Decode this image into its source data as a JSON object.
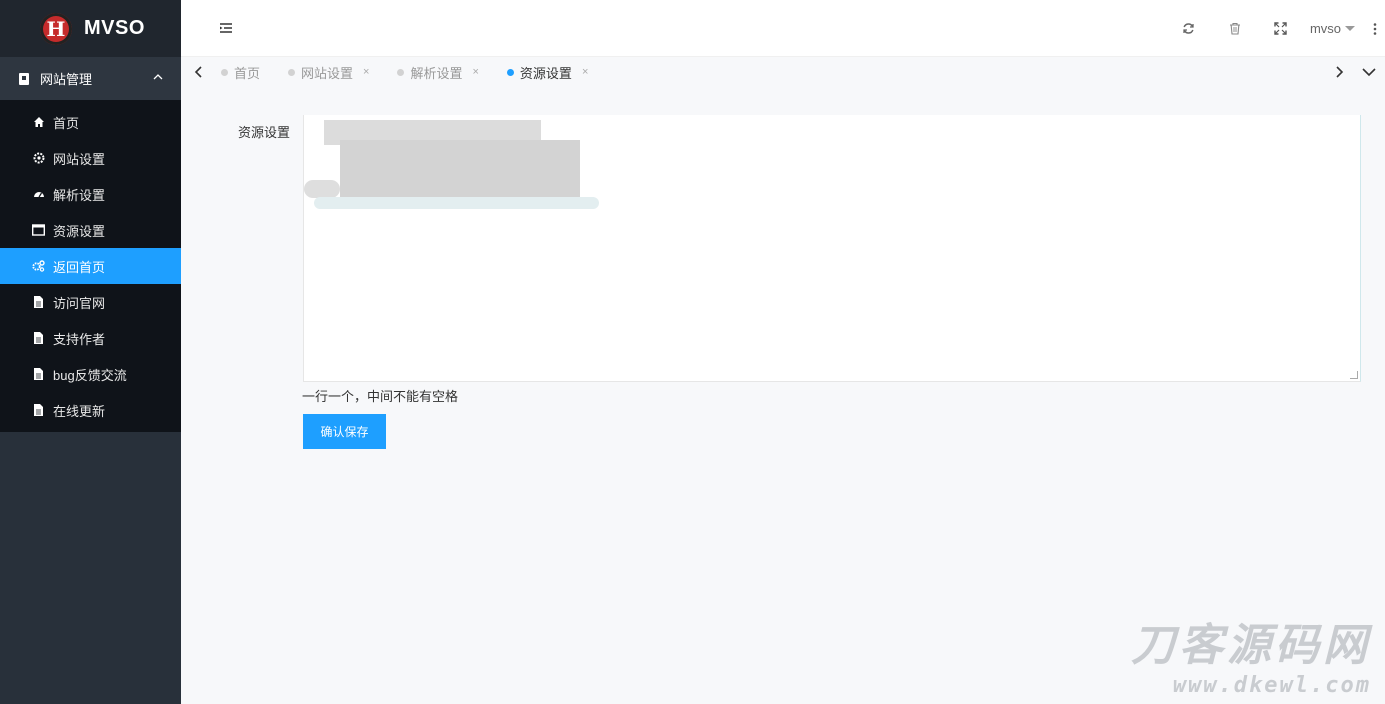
{
  "brand": {
    "logo_letter": "H",
    "name": "MVSO"
  },
  "sidebar": {
    "group_label": "网站管理",
    "items": [
      {
        "label": "首页",
        "icon": "home-icon"
      },
      {
        "label": "网站设置",
        "icon": "gear-icon"
      },
      {
        "label": "解析设置",
        "icon": "dashboard-icon"
      },
      {
        "label": "资源设置",
        "icon": "window-icon"
      },
      {
        "label": "返回首页",
        "icon": "gears-icon",
        "active": true
      },
      {
        "label": "访问官网",
        "icon": "file-icon"
      },
      {
        "label": "支持作者",
        "icon": "file-icon"
      },
      {
        "label": "bug反馈交流",
        "icon": "file-icon"
      },
      {
        "label": "在线更新",
        "icon": "file-icon"
      }
    ]
  },
  "header": {
    "user": "mvso"
  },
  "tabs": [
    {
      "label": "首页",
      "closable": false
    },
    {
      "label": "网站设置",
      "closable": true,
      "close": "×"
    },
    {
      "label": "解析设置",
      "closable": true,
      "close": "×"
    },
    {
      "label": "资源设置",
      "closable": true,
      "close": "×",
      "active": true
    }
  ],
  "form": {
    "label": "资源设置",
    "hint": "一行一个，中间不能有空格",
    "submit_label": "确认保存"
  },
  "watermark": {
    "cn": "刀客源码网",
    "en": "www.dkewl.com"
  },
  "colors": {
    "accent": "#1e9fff",
    "sidebar_bg": "#28303a",
    "submenu_bg": "#0f1319",
    "logo_red": "#c62b2b"
  }
}
